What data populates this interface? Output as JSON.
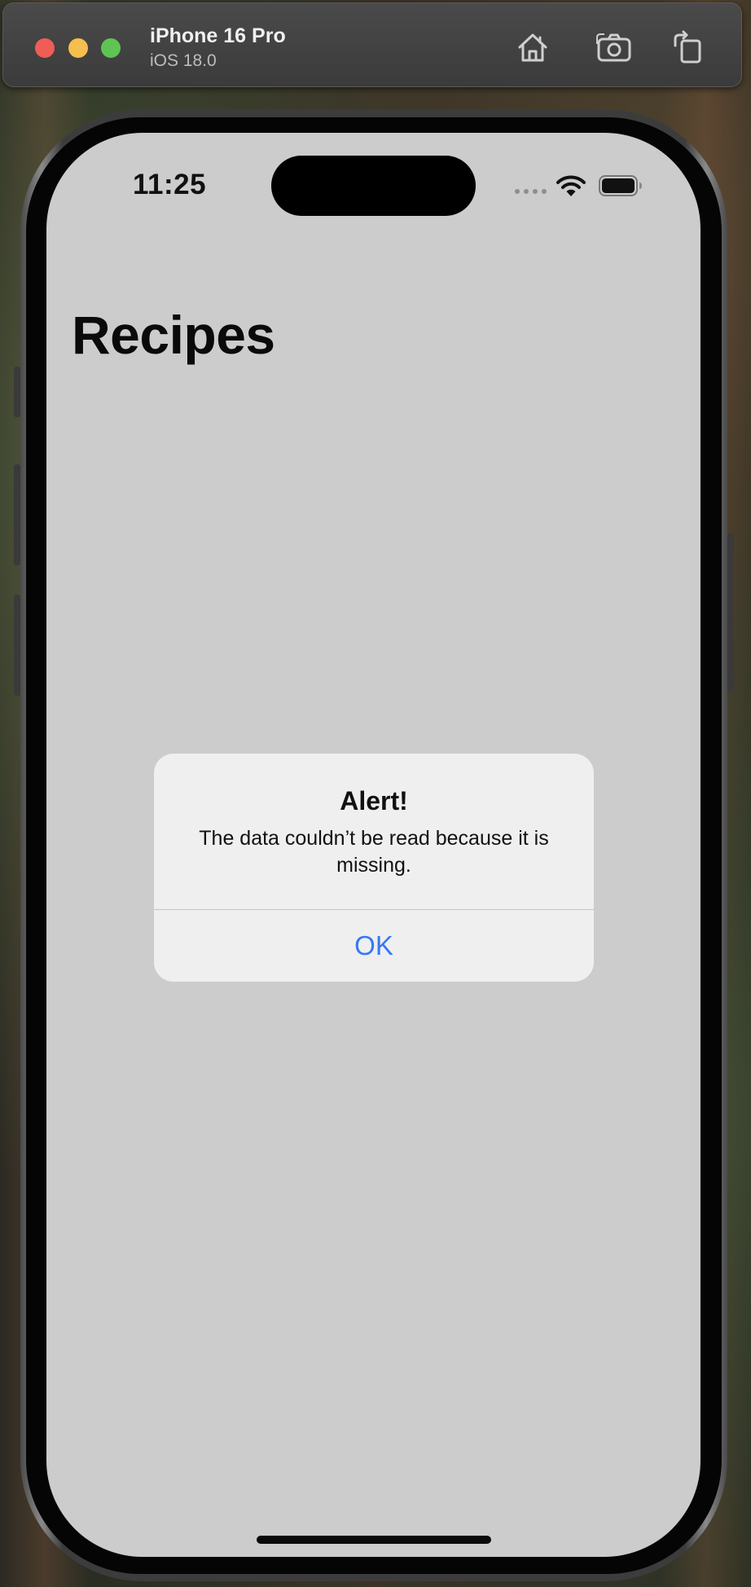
{
  "simulator": {
    "device_name": "iPhone 16 Pro",
    "os_version": "iOS 18.0",
    "controls": [
      "home-icon",
      "screenshot-icon",
      "rotate-icon"
    ]
  },
  "status_bar": {
    "time": "11:25",
    "icons": [
      "cellular-signal-icon",
      "wifi-icon",
      "battery-icon"
    ]
  },
  "navigation": {
    "title": "Recipes"
  },
  "alert": {
    "title": "Alert!",
    "message": "The data couldn’t be read because it is missing.",
    "ok_label": "OK"
  },
  "colors": {
    "screen_background": "#cccccc",
    "alert_background": "#efefef",
    "alert_button": "#3478f6",
    "close_button": "#ee5e57",
    "minimize_button": "#f5be4f",
    "zoom_button": "#5fc454"
  }
}
